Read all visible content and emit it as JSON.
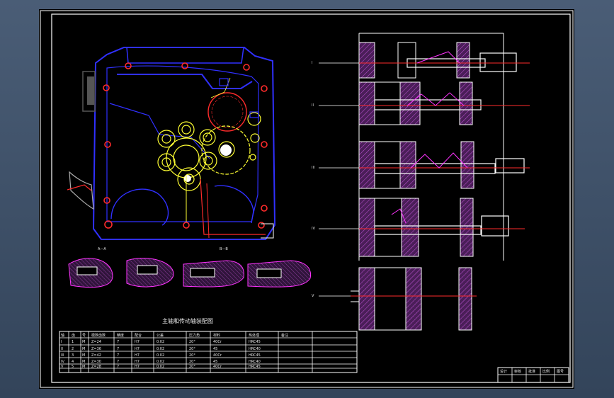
{
  "drawing": {
    "title": "主轴和传动轴装配图",
    "section_a_label": "A-A",
    "section_b_label": "B-B",
    "shaft_labels": [
      "I",
      "II",
      "III",
      "IV",
      "V"
    ],
    "gear_table": {
      "headers": [
        "轴",
        "齿",
        "号",
        "模数齿数",
        "精度",
        "配合",
        "公差",
        "压力角",
        "材料",
        "热处理",
        "备注"
      ],
      "rows": [
        [
          "I",
          "1",
          "M",
          "Z=24",
          "7",
          "H7",
          "0.02",
          "20°",
          "40Cr",
          "HRC45",
          ""
        ],
        [
          "II",
          "2",
          "M",
          "Z=36",
          "7",
          "H7",
          "0.02",
          "20°",
          "45",
          "HRC40",
          ""
        ],
        [
          "III",
          "3",
          "M",
          "Z=42",
          "7",
          "H7",
          "0.02",
          "20°",
          "40Cr",
          "HRC45",
          ""
        ],
        [
          "IV",
          "4",
          "M",
          "Z=30",
          "7",
          "H7",
          "0.02",
          "20°",
          "45",
          "HRC40",
          ""
        ],
        [
          "V",
          "5",
          "M",
          "Z=28",
          "7",
          "H7",
          "0.02",
          "20°",
          "40Cr",
          "HRC45",
          ""
        ]
      ]
    },
    "title_block": [
      "设计",
      "审核",
      "批准",
      "比例",
      "图号"
    ]
  },
  "colors": {
    "background": "#000000",
    "frame": "#ffffff",
    "blue": "#2a2dff",
    "red": "#ff2b2b",
    "yellow": "#ffff33",
    "magenta": "#ff33ff",
    "hatch": "#7d2f8f",
    "green": "#33ff66"
  }
}
